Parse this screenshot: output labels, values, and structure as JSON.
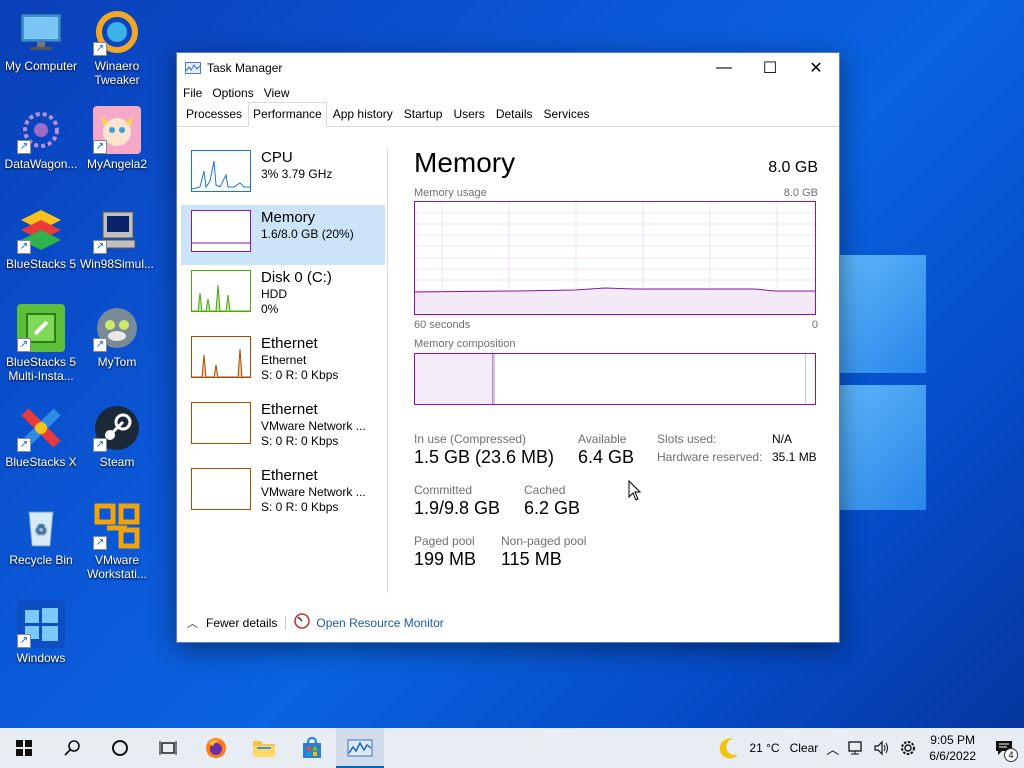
{
  "desktop": {
    "icons": [
      {
        "label": "My Computer",
        "icon": "monitor-icon"
      },
      {
        "label": "Winaero Tweaker",
        "icon": "winaero-icon"
      },
      {
        "label": "DataWagon...",
        "icon": "datawagon-icon"
      },
      {
        "label": "MyAngela2",
        "icon": "angela-icon"
      },
      {
        "label": "BlueStacks 5",
        "icon": "bluestacks-icon"
      },
      {
        "label": "Win98Simul...",
        "icon": "win98-icon"
      },
      {
        "label": "BlueStacks 5 Multi-Insta...",
        "icon": "bluestacks-multi-icon"
      },
      {
        "label": "MyTom",
        "icon": "tom-icon"
      },
      {
        "label": "BlueStacks X",
        "icon": "bluestacks-x-icon"
      },
      {
        "label": "Steam",
        "icon": "steam-icon"
      },
      {
        "label": "Recycle Bin",
        "icon": "recycle-bin-icon"
      },
      {
        "label": "VMware Workstati...",
        "icon": "vmware-icon"
      },
      {
        "label": "Windows",
        "icon": "windows-icon"
      }
    ]
  },
  "window": {
    "title": "Task Manager",
    "controls": {
      "minimize": "—",
      "maximize": "☐",
      "close": "✕"
    },
    "menu": [
      "File",
      "Options",
      "View"
    ],
    "tabs": [
      "Processes",
      "Performance",
      "App history",
      "Startup",
      "Users",
      "Details",
      "Services"
    ],
    "active_tab": "Performance"
  },
  "resources": [
    {
      "name": "CPU",
      "line2": "3%  3.79 GHz",
      "line3": "",
      "color": "#1a76c9"
    },
    {
      "name": "Memory",
      "line2": "1.6/8.0 GB (20%)",
      "line3": "",
      "color": "#8b12ae"
    },
    {
      "name": "Disk 0 (C:)",
      "line2": "HDD",
      "line3": "0%",
      "color": "#4da60c"
    },
    {
      "name": "Ethernet",
      "line2": "Ethernet",
      "line3": "S: 0  R: 0 Kbps",
      "color": "#a74f01"
    },
    {
      "name": "Ethernet",
      "line2": "VMware Network ...",
      "line3": "S: 0  R: 0 Kbps",
      "color": "#a74f01"
    },
    {
      "name": "Ethernet",
      "line2": "VMware Network ...",
      "line3": "S: 0  R: 0 Kbps",
      "color": "#a74f01"
    }
  ],
  "memory": {
    "title": "Memory",
    "total": "8.0 GB",
    "usage_label": "Memory usage",
    "usage_max": "8.0 GB",
    "time_left": "60 seconds",
    "time_right": "0",
    "composition_label": "Memory composition",
    "stats": {
      "in_use_label": "In use (Compressed)",
      "in_use": "1.5 GB (23.6 MB)",
      "available_label": "Available",
      "available": "6.4 GB",
      "committed_label": "Committed",
      "committed": "1.9/9.8 GB",
      "cached_label": "Cached",
      "cached": "6.2 GB",
      "paged_label": "Paged pool",
      "paged": "199 MB",
      "nonpaged_label": "Non-paged pool",
      "nonpaged": "115 MB",
      "slots_label": "Slots used:",
      "slots": "N/A",
      "hw_label": "Hardware reserved:",
      "hw": "35.1 MB"
    }
  },
  "footer": {
    "fewer": "Fewer details",
    "monitor": "Open Resource Monitor"
  },
  "taskbar": {
    "weather_temp": "21 °C",
    "weather_cond": "Clear",
    "time": "9:05 PM",
    "date": "6/6/2022",
    "notif_count": "4"
  }
}
